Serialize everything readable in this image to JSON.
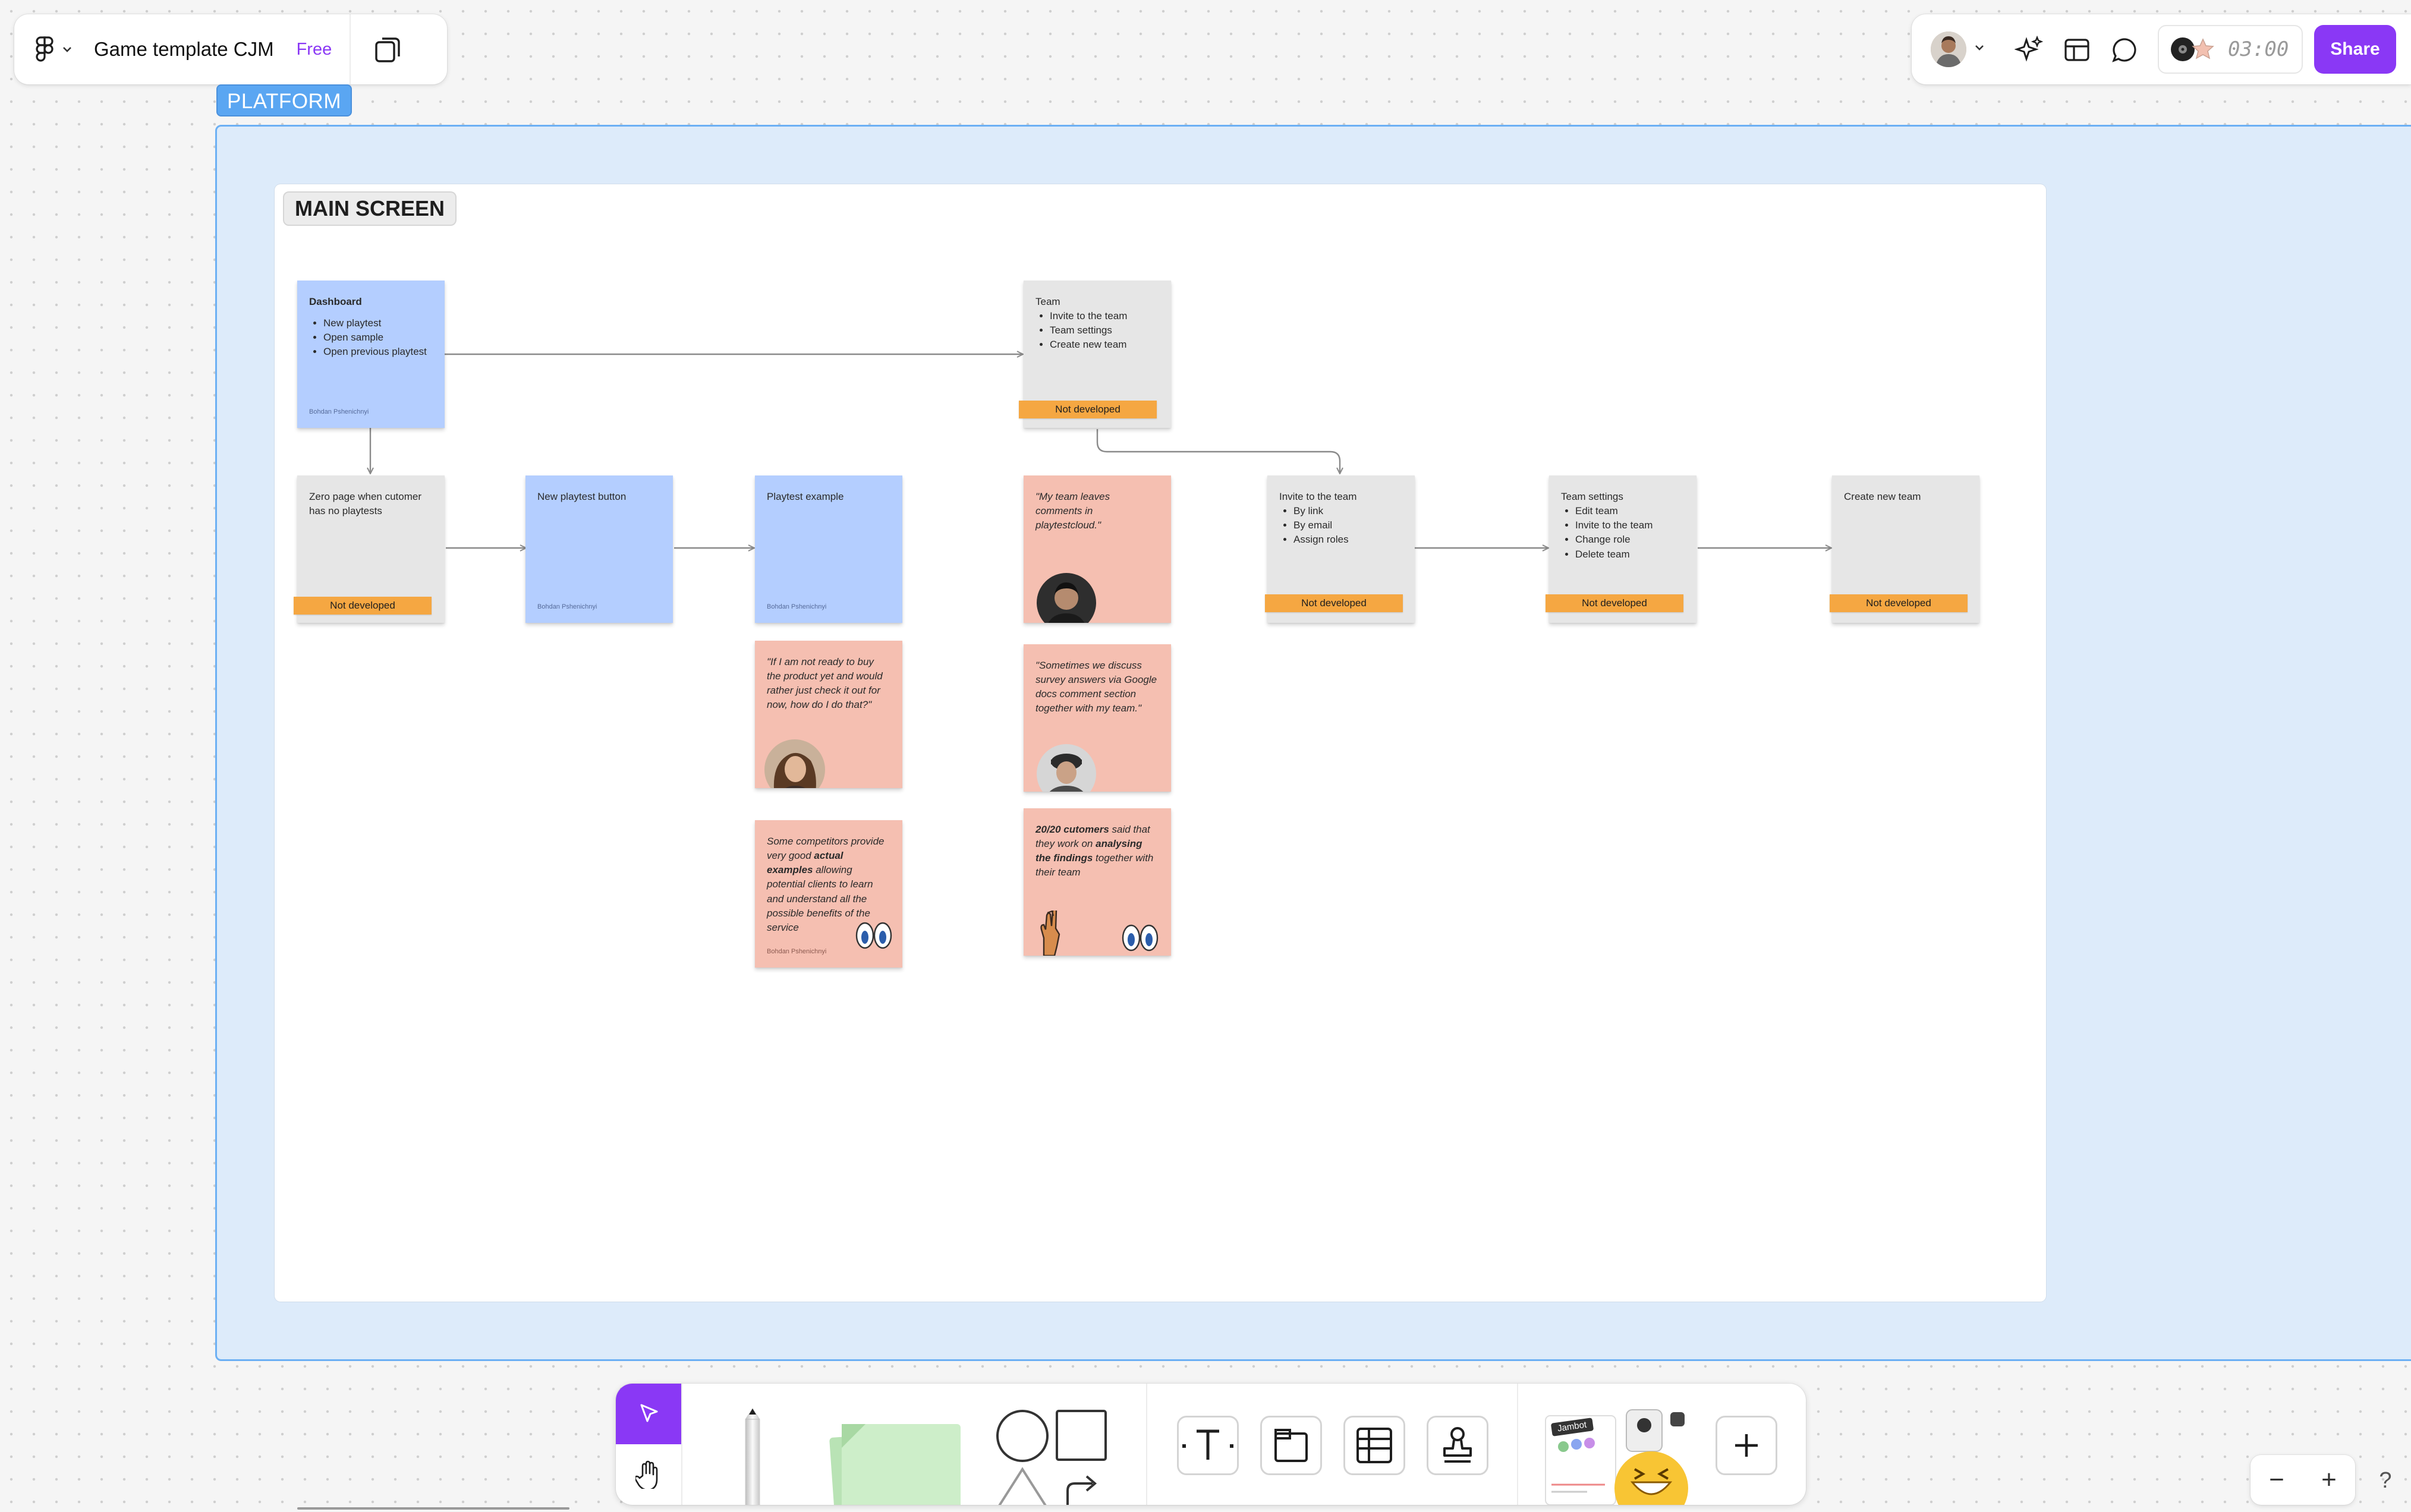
{
  "header": {
    "doc_title": "Game template CJM",
    "plan_badge": "Free",
    "timer": "03:00",
    "share_label": "Share"
  },
  "board": {
    "platform_label": "PLATFORM",
    "main_label": "MAIN SCREEN"
  },
  "stickies": {
    "dashboard": {
      "title": "Dashboard",
      "items": [
        "New playtest",
        "Open sample",
        "Open previous playtest"
      ],
      "author": "Bohdan Pshenichnyi"
    },
    "team": {
      "title": "Team",
      "items": [
        "Invite to the team",
        "Team settings",
        "Create new team"
      ],
      "tag": "Not developed"
    },
    "zero_page": {
      "title": "Zero page when cutomer has no playtests",
      "tag": "Not developed"
    },
    "new_playtest_button": {
      "title": "New playtest button",
      "author": "Bohdan Pshenichnyi"
    },
    "playtest_example": {
      "title": "Playtest example",
      "author": "Bohdan Pshenichnyi"
    },
    "invite": {
      "title": "Invite to the team",
      "items": [
        "By link",
        "By email",
        "Assign roles"
      ],
      "tag": "Not developed"
    },
    "team_settings": {
      "title": "Team settings",
      "items": [
        "Edit team",
        "Invite to the team",
        "Change role",
        "Delete team"
      ],
      "tag": "Not developed"
    },
    "create_team": {
      "title": "Create new team",
      "tag": "Not developed"
    },
    "quote_comments": {
      "text": "\"My team leaves comments in playtestcloud.\""
    },
    "quote_not_ready": {
      "text": "\"If I am not ready to buy the product yet and would rather just check it out for now, how do I do that?\""
    },
    "quote_google_docs": {
      "text": "\"Sometimes we discuss survey answers via Google docs comment section together with my team.\""
    },
    "competitors": {
      "p1": "Some competitors provide very good ",
      "b1": "actual examples",
      "p2": " allowing potential clients to learn and understand all the possible benefits of the service",
      "author": "Bohdan Pshenichnyi"
    },
    "customers": {
      "b1": "20/20 cutomers",
      "p1": " said that they work on ",
      "b2": "analysing the findings",
      "p2": " together with their team"
    }
  },
  "bottom_toolbar": {
    "widget_label": "Jambot"
  },
  "zoom": {
    "minus": "−",
    "plus": "+",
    "help": "?"
  },
  "colors": {
    "accent": "#8a38f5",
    "platform_fill": "#ddebfa",
    "platform_border": "#6cb0f4",
    "sticky_blue": "#b4ceff",
    "sticky_gray": "#e6e6e6",
    "sticky_pink": "#f5bfb1",
    "tag_orange": "#f5a742"
  }
}
